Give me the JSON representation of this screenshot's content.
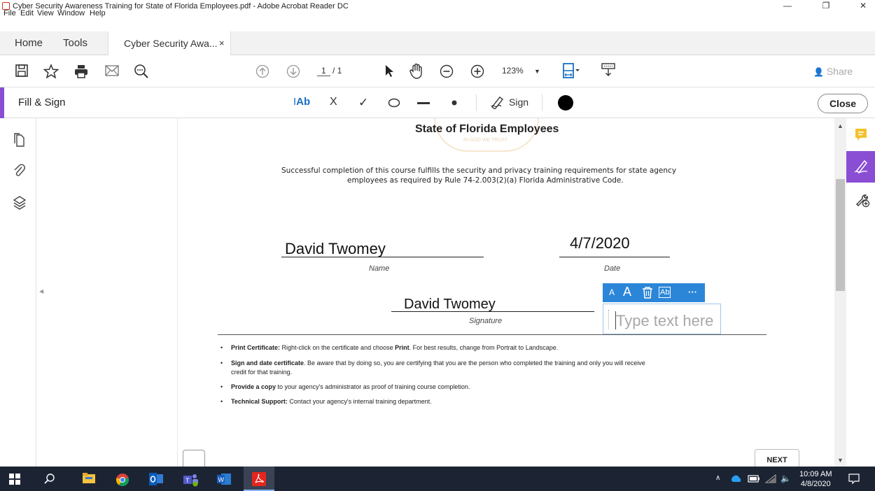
{
  "window": {
    "title": "Cyber Security Awareness Training for State of Florida Employees.pdf - Adobe Acrobat Reader DC",
    "minimize": "—",
    "restore": "❐",
    "close": "✕"
  },
  "menu": [
    "File",
    "Edit",
    "View",
    "Window",
    "Help"
  ],
  "tabs": {
    "home": "Home",
    "tools": "Tools",
    "document": "Cyber Security Awa...",
    "close": "×"
  },
  "toolbar": {
    "page_current": "1",
    "page_total": "/ 1",
    "zoom": "123%",
    "share": "Share"
  },
  "fill_sign": {
    "title": "Fill & Sign",
    "text_tool": "Ab",
    "cross": "X",
    "check": "✓",
    "sign": "Sign",
    "close": "Close",
    "active_color": "#000000"
  },
  "document": {
    "heading": "State of Florida Employees",
    "paragraph_line1": "Successful completion of this course fulfills the security and privacy training requirements for state agency",
    "paragraph_line2": "employees as required by Rule 74-2.003(2)(a) Florida Administrative Code.",
    "name_value": "David Twomey",
    "name_label": "Name",
    "date_value": "4/7/2020",
    "date_label": "Date",
    "signature_value": "David Twomey",
    "signature_label": "Signature",
    "seal_text": "IN GOD WE TRUST",
    "bullets": [
      {
        "bold": "Print Certificate:",
        "rest": " Right-click on the certificate and choose ",
        "bold2": "Print",
        "rest2": ". For best results, change from Portrait to Landscape."
      },
      {
        "bold": "Sign and date certificate",
        "rest": ". Be aware that by doing so, you are certifying that you are the person who completed the training and only you will receive",
        "line2": "credit for that training."
      },
      {
        "bold": "Provide a copy",
        "rest": " to your agency's administrator as proof of training course completion."
      },
      {
        "bold": "Technical Support:",
        "rest": " Contact your agency's internal training department."
      }
    ],
    "next": "NEXT"
  },
  "text_field": {
    "small_a": "A",
    "large_a": "A",
    "ab": "Ab",
    "more": "···",
    "placeholder": "Type text here"
  },
  "taskbar": {
    "time": "10:09 AM",
    "date": "4/8/2020"
  },
  "colors": {
    "accent_purple": "#8a4ed4",
    "field_blue": "#2b86d8",
    "taskbar": "#1c2434",
    "comment_yellow": "#f2c12e"
  }
}
